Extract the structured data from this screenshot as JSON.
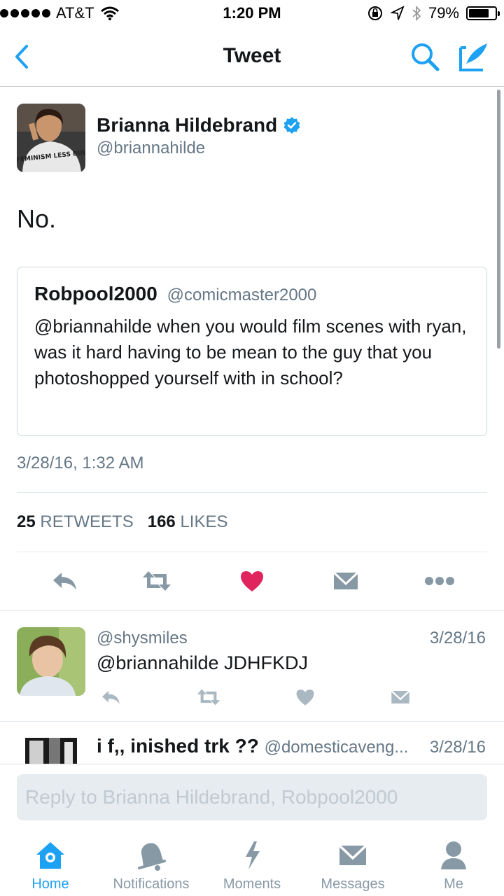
{
  "status_bar": {
    "carrier": "AT&T",
    "time": "1:20 PM",
    "battery": "79%",
    "battery_level": 0.79
  },
  "nav": {
    "title": "Tweet",
    "back_icon": "chevron-left-icon",
    "search_icon": "search-icon",
    "compose_icon": "compose-icon"
  },
  "tweet": {
    "author_name": "Brianna Hildebrand",
    "author_handle": "@briannahilde",
    "avatar_shirt_text": "MORE FEMINISM LESS BULLSHIT",
    "text": "No.",
    "quote": {
      "name": "Robpool2000",
      "handle": "@comicmaster2000",
      "text": "@briannahilde when you would film scenes with ryan, was it hard having to be mean to the guy that you photoshopped yourself with in school?"
    },
    "timestamp": "3/28/16, 1:32 AM",
    "retweet_count": "25",
    "retweet_label": "RETWEETS",
    "like_count": "166",
    "like_label": "LIKES"
  },
  "replies": [
    {
      "handle": "@shysmiles",
      "date": "3/28/16",
      "text": "@briannahilde JDHFKDJ"
    },
    {
      "name": "i f,, inished trk ??",
      "handle": "@domesticaveng...",
      "date": "3/28/16"
    }
  ],
  "reply_box": {
    "placeholder": "Reply to Brianna Hildebrand, Robpool2000"
  },
  "tabs": [
    {
      "label": "Home",
      "icon": "home-icon",
      "active": true
    },
    {
      "label": "Notifications",
      "icon": "bell-icon",
      "active": false
    },
    {
      "label": "Moments",
      "icon": "lightning-icon",
      "active": false
    },
    {
      "label": "Messages",
      "icon": "envelope-icon",
      "active": false
    },
    {
      "label": "Me",
      "icon": "person-icon",
      "active": false
    }
  ],
  "colors": {
    "accent": "#1da1f2",
    "like_red": "#e0245e",
    "muted": "#657786",
    "icon_gray": "#8899a6"
  }
}
